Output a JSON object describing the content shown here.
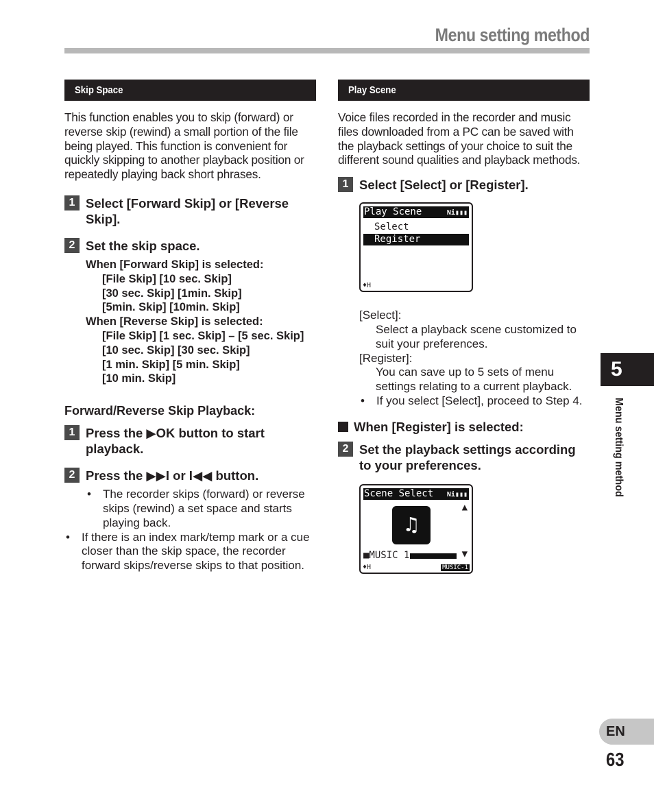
{
  "header": {
    "title": "Menu setting method"
  },
  "left": {
    "section_title": "Skip Space",
    "intro": "This function enables you to skip (forward) or reverse skip (rewind) a small portion of the file being played. This function is convenient for quickly skipping to another playback position or repeatedly playing back short phrases.",
    "step1": {
      "num": "1",
      "text": "Select [Forward Skip] or [Reverse Skip]."
    },
    "step2": {
      "num": "2",
      "text": "Set the skip space."
    },
    "forward_heading": "When [Forward Skip] is selected:",
    "forward_options": [
      "[File Skip] [10 sec. Skip]",
      "[30 sec. Skip] [1min. Skip]",
      "[5min. Skip] [10min. Skip]"
    ],
    "reverse_heading": "When [Reverse Skip] is selected:",
    "reverse_options": [
      "[File Skip] [1 sec. Skip] – [5 sec. Skip]",
      "[10 sec. Skip] [30 sec. Skip]",
      "[1 min. Skip] [5 min. Skip]",
      "[10 min. Skip]"
    ],
    "playback_heading": "Forward/Reverse Skip Playback:",
    "pb_step1": {
      "num": "1",
      "text": "Press the ▶OK button to start playback."
    },
    "pb_step2": {
      "num": "2",
      "text": "Press the ▶▶I or I◀◀ button."
    },
    "pb_note1": "The recorder skips (forward) or reverse skips (rewind) a set space and starts playing back.",
    "pb_note2": "If there is an index mark/temp mark or a cue closer than the skip space, the recorder forward skips/reverse skips to that position."
  },
  "right": {
    "section_title": "Play Scene",
    "intro": "Voice files recorded in the recorder and music files downloaded from a PC can be saved with the playback settings of your choice to suit the different sound qualities and playback methods.",
    "step1": {
      "num": "1",
      "text": "Select [Select] or [Register]."
    },
    "lcd1": {
      "header": "Play Scene",
      "battery": "Ni▮▮▮",
      "items": [
        "Select",
        "Register"
      ],
      "selected": "Register",
      "footer": "♦H"
    },
    "select_label": "[Select]:",
    "select_desc": "Select a playback scene customized to suit your preferences.",
    "register_label": "[Register]:",
    "register_desc": "You can save up to 5 sets of menu settings relating to a current playback.",
    "note": "If you select [Select], proceed to Step 4.",
    "when_register": "When [Register] is selected:",
    "step2": {
      "num": "2",
      "text": "Set the playback settings according to your preferences."
    },
    "lcd2": {
      "header": "Scene Select",
      "battery": "Ni▮▮▮",
      "item": "■MUSIC 1",
      "footer_left": "♦H",
      "footer_right": "MUSIC-1",
      "icon": "music-notes-icon"
    }
  },
  "side": {
    "chapter": "5",
    "chapter_label": "Menu setting method",
    "lang": "EN",
    "page": "63"
  }
}
